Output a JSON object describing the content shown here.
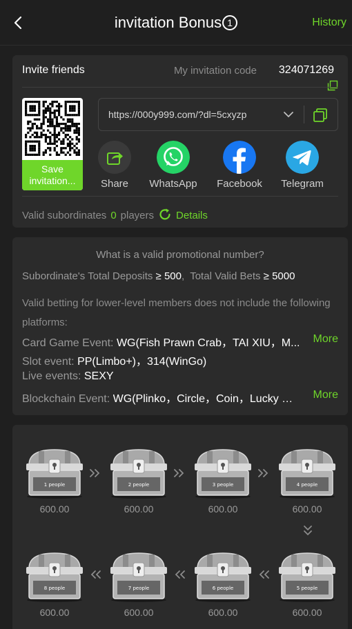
{
  "header": {
    "title": "invitation Bonus",
    "title_badge": "1",
    "history_label": "History"
  },
  "invite": {
    "title": "Invite friends",
    "code_label": "My invitation code",
    "code_value": "324071269",
    "link": "https://000y999.com/?dl=5cxyzp",
    "save_label": "Save invitation..."
  },
  "share": [
    {
      "label": "Share",
      "icon": "share-icon"
    },
    {
      "label": "WhatsApp",
      "icon": "whatsapp-icon",
      "color": "#25d366"
    },
    {
      "label": "Facebook",
      "icon": "facebook-icon",
      "color": "#1877f2"
    },
    {
      "label": "Telegram",
      "icon": "telegram-icon",
      "color": "#2aa7e4"
    }
  ],
  "subordinates": {
    "label": "Valid subordinates",
    "count": "0",
    "unit": "players",
    "details_label": "Details"
  },
  "rules": {
    "question": "What is a valid promotional number?",
    "deposit_label": "Subordinate's Total Deposits",
    "deposit_value": "≥ 500",
    "bets_label": "Total Valid Bets",
    "bets_value": "≥ 5000",
    "note": "Valid betting for lower-level members does not include the following platforms:",
    "events": [
      {
        "label": "Card Game Event:",
        "value": "WG(Fish Prawn Crab，TAI XIU，M...",
        "more": "More"
      },
      {
        "label": "Slot event:",
        "value": "PP(Limbo+)，314(WinGo)"
      },
      {
        "label": "Live events:",
        "value": "SEXY"
      },
      {
        "label": "Blockchain Event:",
        "value": "WG(Plinko，Circle，Coin，Lucky Di...",
        "more": "More"
      }
    ]
  },
  "chests": [
    {
      "label": "1 people",
      "amount": "600.00"
    },
    {
      "label": "2 people",
      "amount": "600.00"
    },
    {
      "label": "3 people",
      "amount": "600.00"
    },
    {
      "label": "4 people",
      "amount": "600.00"
    },
    {
      "label": "5 people",
      "amount": "600.00"
    },
    {
      "label": "6 people",
      "amount": "600.00"
    },
    {
      "label": "7 people",
      "amount": "600.00"
    },
    {
      "label": "8 people",
      "amount": "600.00"
    }
  ],
  "colors": {
    "accent": "#6fd62a",
    "background": "#1f1f1f",
    "card": "#2b2b2b"
  }
}
